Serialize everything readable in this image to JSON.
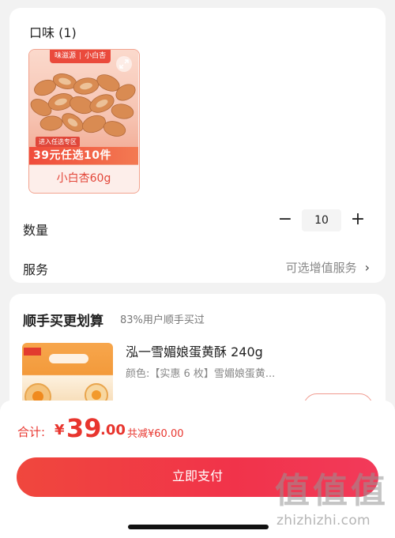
{
  "flavor": {
    "title": "口味 (1)",
    "variant": {
      "brand_tag": "味滋源",
      "brand_tag_sub": "小白杏",
      "promo_small": "进入任选专区",
      "promo_big": "39元任选10件",
      "name": "小白杏60g",
      "icons": {
        "expand": "expand-icon"
      }
    }
  },
  "quantity": {
    "label": "数量",
    "minus": "−",
    "value": "10",
    "plus": "+"
  },
  "service": {
    "label": "服务",
    "value": "可选增值服务",
    "chevron": "›"
  },
  "bundle": {
    "title": "顺手买更划算",
    "subtitle": "83%用户顺手买过",
    "product_name": "泓一雪媚娘蛋黄酥 240g",
    "product_spec": "颜色:【实惠 6 枚】雪媚娘蛋黄..."
  },
  "checkout": {
    "total_label": "合计:",
    "currency": "¥",
    "total_int": "39",
    "total_dec": ".00",
    "saved": "共减¥60.00",
    "pay_button": "立即支付"
  },
  "watermark": {
    "logo_glyphs": [
      "值",
      "值",
      "值"
    ],
    "url": "zhizhizhi.com"
  },
  "colors": {
    "accent": "#e8352e",
    "pay_gradient_start": "#f0473d",
    "pay_gradient_end": "#f23a5a",
    "variant_border": "#f2a38f"
  }
}
